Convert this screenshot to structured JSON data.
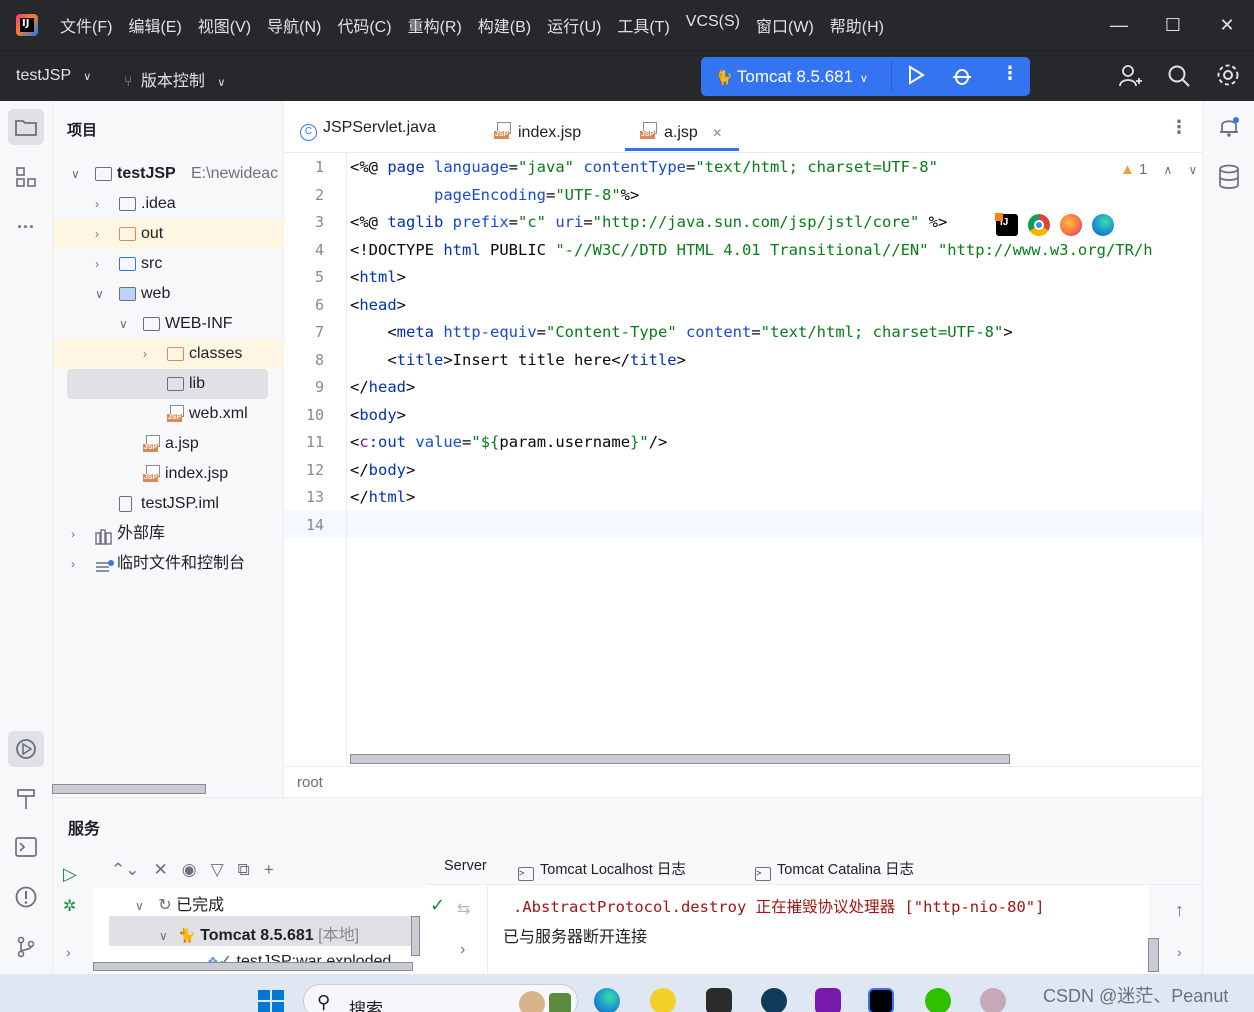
{
  "titlebar": {
    "menus": [
      "文件(F)",
      "编辑(E)",
      "视图(V)",
      "导航(N)",
      "代码(C)",
      "重构(R)",
      "构建(B)",
      "运行(U)",
      "工具(T)",
      "VCS(S)",
      "窗口(W)",
      "帮助(H)"
    ],
    "minimize": "—",
    "maximize": "☐",
    "close": "✕"
  },
  "toolbar": {
    "project_name": "testJSP",
    "vcs_label": "版本控制",
    "run_config": "Tomcat 8.5.681",
    "run_icon": "play-icon",
    "debug_icon": "bug-icon"
  },
  "project_panel": {
    "title": "项目",
    "tree": [
      {
        "label": "testJSP",
        "suffix": "E:\\newideac",
        "kind": "module",
        "level": 0,
        "expanded": true
      },
      {
        "label": ".idea",
        "kind": "folder",
        "level": 1,
        "expanded": false
      },
      {
        "label": "out",
        "kind": "folder-orange",
        "level": 1,
        "expanded": false
      },
      {
        "label": "src",
        "kind": "folder-blue",
        "level": 1,
        "expanded": false
      },
      {
        "label": "web",
        "kind": "folder-web",
        "level": 1,
        "expanded": true
      },
      {
        "label": "WEB-INF",
        "kind": "folder",
        "level": 2,
        "expanded": true
      },
      {
        "label": "classes",
        "kind": "folder-orange",
        "level": 3,
        "expanded": false
      },
      {
        "label": "lib",
        "kind": "folder",
        "level": 3
      },
      {
        "label": "web.xml",
        "kind": "xml",
        "level": 3
      },
      {
        "label": "a.jsp",
        "kind": "jsp",
        "level": 2
      },
      {
        "label": "index.jsp",
        "kind": "jsp",
        "level": 2
      },
      {
        "label": "testJSP.iml",
        "kind": "iml",
        "level": 1
      },
      {
        "label": "外部库",
        "kind": "lib",
        "level": 0,
        "expanded": false
      },
      {
        "label": "临时文件和控制台",
        "kind": "scratch",
        "level": 0,
        "expanded": false
      }
    ]
  },
  "editor": {
    "tabs": [
      {
        "label": "JSPServlet.java",
        "icon": "java-class-icon"
      },
      {
        "label": "index.jsp",
        "icon": "jsp-file-icon"
      },
      {
        "label": "a.jsp",
        "icon": "jsp-file-icon",
        "active": true,
        "close": "✕"
      }
    ],
    "warnings": "1",
    "line_numbers": [
      "1",
      "2",
      "3",
      "4",
      "5",
      "6",
      "7",
      "8",
      "9",
      "10",
      "11",
      "12",
      "13",
      "14"
    ],
    "lines": [
      [
        [
          "<%@ ",
          "t"
        ],
        [
          "page ",
          "kw"
        ],
        [
          "language",
          "attr"
        ],
        [
          "=",
          "t"
        ],
        [
          "\"java\" ",
          "str"
        ],
        [
          "contentType",
          "attr"
        ],
        [
          "=",
          "t"
        ],
        [
          "\"text/html; charset=UTF-8\"",
          "str"
        ]
      ],
      [
        [
          "         ",
          "t"
        ],
        [
          "pageEncoding",
          "attr"
        ],
        [
          "=",
          "t"
        ],
        [
          "\"UTF-8\"",
          "str"
        ],
        [
          "%>",
          "t"
        ]
      ],
      [
        [
          "<%@ ",
          "t"
        ],
        [
          "taglib ",
          "kw"
        ],
        [
          "prefix",
          "attr"
        ],
        [
          "=",
          "t"
        ],
        [
          "\"c\" ",
          "str"
        ],
        [
          "uri",
          "attr"
        ],
        [
          "=",
          "t"
        ],
        [
          "\"http://java.sun.com/jsp/jstl/core\" ",
          "str"
        ],
        [
          "%>",
          "t"
        ]
      ],
      [
        [
          "<!DOCTYPE ",
          "t"
        ],
        [
          "html ",
          "kw"
        ],
        [
          "PUBLIC ",
          "t"
        ],
        [
          "\"-//W3C//DTD HTML 4.01 Transitional//EN\" ",
          "str"
        ],
        [
          "\"http://www.w3.org/TR/h",
          "str"
        ]
      ],
      [
        [
          "<",
          "t"
        ],
        [
          "html",
          "tag"
        ],
        [
          ">",
          "t"
        ]
      ],
      [
        [
          "<",
          "t"
        ],
        [
          "head",
          "tag"
        ],
        [
          ">",
          "t"
        ]
      ],
      [
        [
          "    <",
          "t"
        ],
        [
          "meta ",
          "tag"
        ],
        [
          "http-equiv",
          "attr"
        ],
        [
          "=",
          "t"
        ],
        [
          "\"Content-Type\" ",
          "str"
        ],
        [
          "content",
          "attr"
        ],
        [
          "=",
          "t"
        ],
        [
          "\"text/html; charset=UTF-8\"",
          "str"
        ],
        [
          ">",
          "t"
        ]
      ],
      [
        [
          "    <",
          "t"
        ],
        [
          "title",
          "tag"
        ],
        [
          ">Insert title here</",
          "t"
        ],
        [
          "title",
          "tag"
        ],
        [
          ">",
          "t"
        ]
      ],
      [
        [
          "</",
          "t"
        ],
        [
          "head",
          "tag"
        ],
        [
          ">",
          "t"
        ]
      ],
      [
        [
          "<",
          "t"
        ],
        [
          "body",
          "tag"
        ],
        [
          ">",
          "t"
        ]
      ],
      [
        [
          "<",
          "t"
        ],
        [
          "c",
          "ns"
        ],
        [
          ":out ",
          "tag"
        ],
        [
          "value",
          "attr"
        ],
        [
          "=",
          "t"
        ],
        [
          "\"${",
          "str"
        ],
        [
          "param.username",
          "t"
        ],
        [
          "}\"",
          "str"
        ],
        [
          "/>",
          "t"
        ]
      ],
      [
        [
          "</",
          "t"
        ],
        [
          "body",
          "tag"
        ],
        [
          ">",
          "t"
        ]
      ],
      [
        [
          "</",
          "t"
        ],
        [
          "html",
          "tag"
        ],
        [
          ">",
          "t"
        ]
      ],
      [
        [
          "",
          "t"
        ]
      ]
    ],
    "breadcrumb": "root"
  },
  "services": {
    "title": "服务",
    "tree": {
      "group": "已完成",
      "server": "Tomcat 8.5.681",
      "server_tag": "[本地]",
      "artifact": "testJSP:war exploded"
    },
    "tabs": [
      "Server",
      "Tomcat Localhost 日志",
      "Tomcat Catalina 日志"
    ],
    "log": [
      {
        "text": ".AbstractProtocol.destroy 正在摧毁协议处理器 [\"http-nio-80\"]",
        "color": "#a31515"
      },
      {
        "text": "已与服务器断开连接",
        "color": "#1e1f22"
      }
    ]
  },
  "taskbar": {
    "search": "搜索",
    "watermark": "CSDN @迷茫、Peanut"
  },
  "colors": {
    "accent": "#3574f0",
    "titlebar": "#27282c"
  }
}
